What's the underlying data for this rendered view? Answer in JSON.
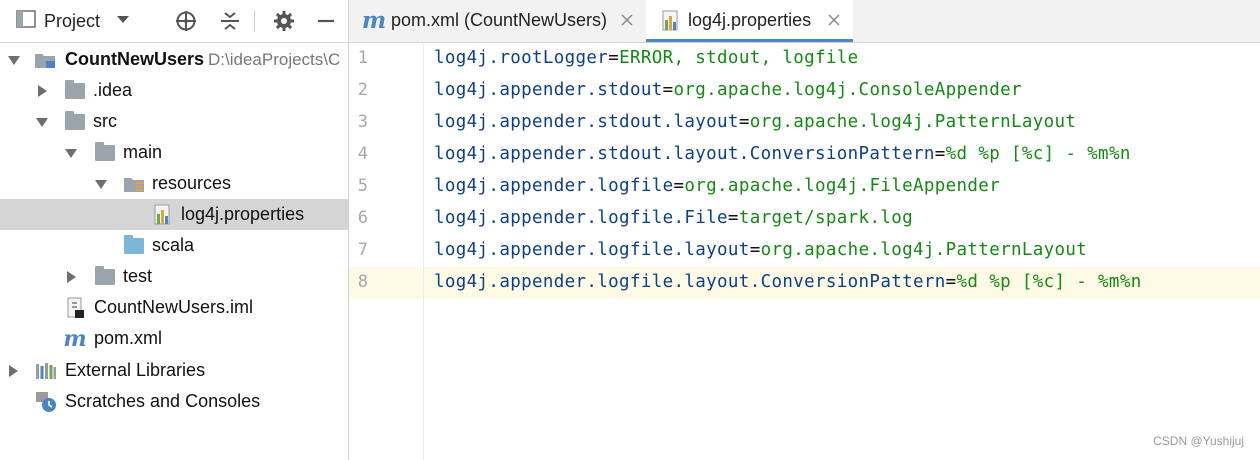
{
  "panel": {
    "title": "Project"
  },
  "tree": [
    {
      "label": "CountNewUsers",
      "path": "D:\\ideaProjects\\C",
      "bold": true,
      "icon": "module-folder-icon",
      "arrow": "expanded"
    },
    {
      "label": ".idea",
      "icon": "folder-icon",
      "arrow": "collapsed"
    },
    {
      "label": "src",
      "icon": "folder-icon",
      "arrow": "expanded"
    },
    {
      "label": "main",
      "icon": "folder-icon",
      "arrow": "expanded"
    },
    {
      "label": "resources",
      "icon": "resources-folder-icon",
      "arrow": "expanded"
    },
    {
      "label": "log4j.properties",
      "icon": "properties-file-icon",
      "selected": true
    },
    {
      "label": "scala",
      "icon": "source-folder-icon"
    },
    {
      "label": "test",
      "icon": "folder-icon",
      "arrow": "collapsed"
    },
    {
      "label": "CountNewUsers.iml",
      "icon": "iml-file-icon"
    },
    {
      "label": "pom.xml",
      "icon": "maven-icon"
    },
    {
      "label": "External Libraries",
      "icon": "libraries-icon",
      "arrow": "collapsed"
    },
    {
      "label": "Scratches and Consoles",
      "icon": "scratches-icon"
    }
  ],
  "tabs": [
    {
      "label": "pom.xml (CountNewUsers)",
      "icon": "maven-icon",
      "active": false
    },
    {
      "label": "log4j.properties",
      "icon": "properties-file-icon",
      "active": true
    }
  ],
  "editor": {
    "current_line": 8,
    "lines": [
      {
        "num": "1",
        "key": "log4j.rootLogger",
        "value": "ERROR, stdout, logfile"
      },
      {
        "num": "2",
        "key": "log4j.appender.stdout",
        "value": "org.apache.log4j.ConsoleAppender"
      },
      {
        "num": "3",
        "key": "log4j.appender.stdout.layout",
        "value": "org.apache.log4j.PatternLayout"
      },
      {
        "num": "4",
        "key": "log4j.appender.stdout.layout.ConversionPattern",
        "value": "%d %p [%c] - %m%n"
      },
      {
        "num": "5",
        "key": "log4j.appender.logfile",
        "value": "org.apache.log4j.FileAppender"
      },
      {
        "num": "6",
        "key": "log4j.appender.logfile.File",
        "value": "target/spark.log"
      },
      {
        "num": "7",
        "key": "log4j.appender.logfile.layout",
        "value": "org.apache.log4j.PatternLayout"
      },
      {
        "num": "8",
        "key": "log4j.appender.logfile.layout.ConversionPattern",
        "value": "%d %p [%c] - %m%n"
      }
    ]
  },
  "watermark": "CSDN @Yushijuj",
  "colors": {
    "key": "#0e3e8c",
    "value": "#148a14",
    "selected_row": "#d5d5d5",
    "current_line": "#fdfbe6",
    "active_tab_underline": "#4a88c7"
  }
}
